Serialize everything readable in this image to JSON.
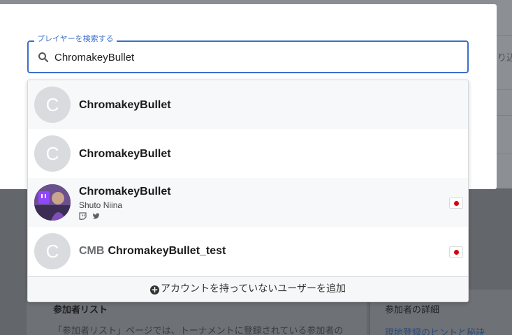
{
  "background": {
    "cut_text": "り込",
    "section_title": "参加者リスト",
    "section_text": "「参加者リスト」ページでは、トーナメントに登録されている参加者の",
    "side_title": "参加者の詳細",
    "side_link": "現地登録のヒントと秘訣"
  },
  "search": {
    "legend": "プレイヤーを検索する",
    "value": "ChromakeyBullet",
    "icon": "search-icon"
  },
  "results": [
    {
      "avatar_letter": "C",
      "tag": "",
      "name": "ChromakeyBullet",
      "subname": "",
      "has_flag": false,
      "socials": []
    },
    {
      "avatar_letter": "C",
      "tag": "",
      "name": "ChromakeyBullet",
      "subname": "",
      "has_flag": false,
      "socials": []
    },
    {
      "avatar_letter": "",
      "tag": "",
      "name": "ChromakeyBullet",
      "subname": "Shuto Niina",
      "has_flag": true,
      "socials": [
        "twitch-icon",
        "twitter-icon"
      ]
    },
    {
      "avatar_letter": "C",
      "tag": "CMB",
      "name": "ChromakeyBullet_test",
      "subname": "",
      "has_flag": true,
      "socials": []
    }
  ],
  "add_user": {
    "label": "アカウントを持っていないユーザーを追加",
    "icon_glyph": "+"
  },
  "colors": {
    "accent": "#3b6fc7",
    "flag_red": "#d7000f"
  }
}
